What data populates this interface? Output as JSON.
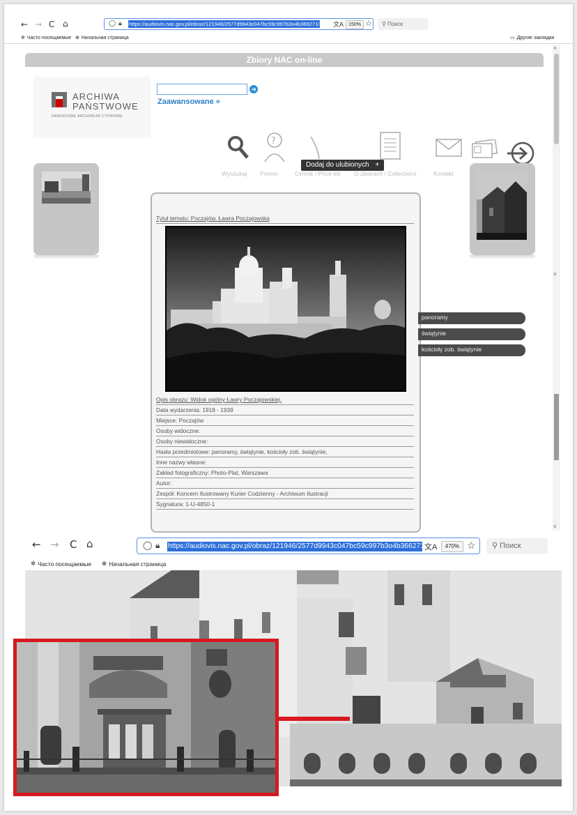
{
  "browser_top": {
    "url": "https://audiovis.nac.gov.pl/obraz/121946/2577d9943c047bc59c997b3o4b366271/",
    "zoom": "150%",
    "search_placeholder": "Поиск",
    "bookmark_1": "Часто посещаемые",
    "bookmark_2": "Начальная страница",
    "other_bookmarks": "Другие закладки"
  },
  "site": {
    "header_title": "Zbiory NAC on-line",
    "logo_line1": "ARCHIWA",
    "logo_line2": "PAŃSTWOWE",
    "logo_subtitle": "NARODOWE ARCHIWUM CYFROWE",
    "advanced_link": "Zaawansowane »",
    "menu": {
      "search": "Wyszukaj",
      "help": "Pomoc",
      "pricelist": "Cennik / Price list",
      "collections": "O zbiorach / Collections",
      "contact": "Kontakt"
    },
    "tooltip": "Dodaj do ulubionych",
    "tooltip_plus": "+"
  },
  "record": {
    "title": "Tytuł tematu: Poczajów. Ławra Poczajowska",
    "description": "Opis obrazu: Widok ogólny Ławry Poczajowskiej.",
    "date": "Data wydarzenia: 1918 - 1939",
    "place": "Miejsce: Poczajów",
    "visible_persons": "Osoby widoczne:",
    "invisible_persons": "Osoby niewidoczne:",
    "subjects": "Hasła przedmiotowe: panoramy, świątynie, kościoły zob. świątynie,",
    "other_names": "Inne nazwy własne:",
    "studio": "Zakład fotograficzny: Photo-Plat, Warszawa",
    "author": "Autor:",
    "fonds": "Zespół: Koncern Ilustrowany Kurier Codzienny - Archiwum Ilustracji",
    "signature": "Sygnatura: 1-U-4850-1"
  },
  "tags": [
    "panoramy",
    "świątynie",
    "kościoły zob. świątynie"
  ],
  "browser_bottom": {
    "url": "https://audiovis.nac.gov.pl/obraz/121946/2577d9943c047bc59c997b3o4b366271/",
    "zoom": "470%",
    "search_placeholder": "Поиск",
    "bookmark_1": "Часто посещаемые",
    "bookmark_2": "Начальная страница"
  },
  "colors": {
    "url_highlight": "#2d6fd9",
    "inset_border": "#d7191f",
    "tag_bg": "#4b4b4b",
    "site_link": "#2e7fc4"
  }
}
